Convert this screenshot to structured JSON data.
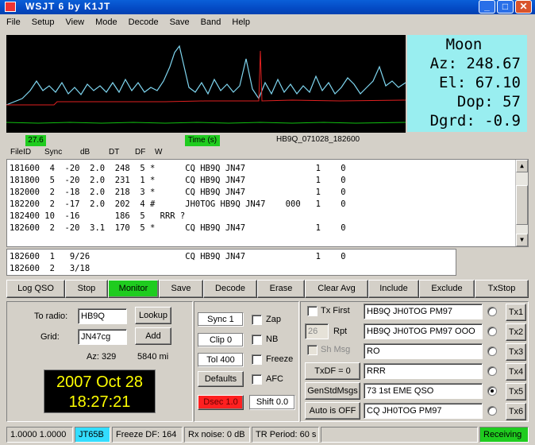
{
  "window": {
    "title": "WSJT 6    by K1JT",
    "min_label": "_",
    "max_label": "□",
    "close_label": "✕"
  },
  "menu": [
    "File",
    "Setup",
    "View",
    "Mode",
    "Decode",
    "Save",
    "Band",
    "Help"
  ],
  "graph": {
    "scale_value": "27.6",
    "time_label": "Time (s)",
    "file_label": "HB9Q_071028_182600"
  },
  "moon": {
    "title": "Moon",
    "az": "Az: 248.67",
    "el": "El:  67.10",
    "dop": "Dop:    57",
    "dgrd": "Dgrd:  -0.9"
  },
  "decode_header": {
    "fileid": "FileID",
    "sync": "Sync",
    "db": "dB",
    "dt": "DT",
    "df": "DF",
    "w": "W"
  },
  "decode_lines": [
    "181600  4  -20  2.0  248  5 *      CQ HB9Q JN47              1    0",
    "181800  5  -20  2.0  231  1 *      CQ HB9Q JN47              1    0",
    "182000  2  -18  2.0  218  3 *      CQ HB9Q JN47              1    0",
    "182200  2  -17  2.0  202  4 #      JH0TOG HB9Q JN47    000   1    0",
    "182400 10  -16       186  5   RRR ?",
    "182600  2  -20  3.1  170  5 *      CQ HB9Q JN47              1    0"
  ],
  "avg_lines": [
    "182600  1   9/26                   CQ HB9Q JN47              1    0",
    "182600  2   3/18"
  ],
  "buttons": {
    "logqso": "Log QSO",
    "stop": "Stop",
    "monitor": "Monitor",
    "save": "Save",
    "decode": "Decode",
    "erase": "Erase",
    "clearavg": "Clear Avg",
    "include": "Include",
    "exclude": "Exclude",
    "txstop": "TxStop"
  },
  "station": {
    "to_radio_label": "To radio:",
    "to_radio": "HB9Q",
    "grid_label": "Grid:",
    "grid": "JN47cg",
    "lookup": "Lookup",
    "add": "Add",
    "az": "Az: 329",
    "dist": "5840 mi"
  },
  "clock": {
    "date": "2007 Oct 28",
    "time": "18:27:21"
  },
  "controls": {
    "sync": "Sync   1",
    "clip": "Clip   0",
    "tol": "Tol   400",
    "defaults": "Defaults",
    "dsec": "Dsec  1.0",
    "shift": "Shift 0.0",
    "zap": "Zap",
    "nb": "NB",
    "freeze": "Freeze",
    "afc": "AFC"
  },
  "tx": {
    "txfirst": "Tx First",
    "rpt_value": "26",
    "rpt_label": "Rpt",
    "shmsg": "Sh Msg",
    "txdf": "TxDF = 0",
    "genstd": "GenStdMsgs",
    "auto": "Auto is OFF",
    "msgs": [
      "HB9Q JH0TOG PM97",
      "HB9Q JH0TOG PM97 OOO",
      "RO",
      "RRR",
      "73 1st EME QSO",
      "CQ JH0TOG PM97"
    ],
    "txbtns": [
      "Tx1",
      "Tx2",
      "Tx3",
      "Tx4",
      "Tx5",
      "Tx6"
    ],
    "selected": 4
  },
  "status": {
    "ratio": "1.0000 1.0000",
    "mode": "JT65B",
    "freeze_df": "Freeze DF:  164",
    "rxnoise": "Rx noise:  0 dB",
    "trperiod": "TR Period:  60 s",
    "state": "Receiving"
  },
  "colors": {
    "green": "#1fcc1f",
    "cyan": "#99eef0",
    "red": "#ff2020",
    "title_blue": "#0449c4"
  }
}
